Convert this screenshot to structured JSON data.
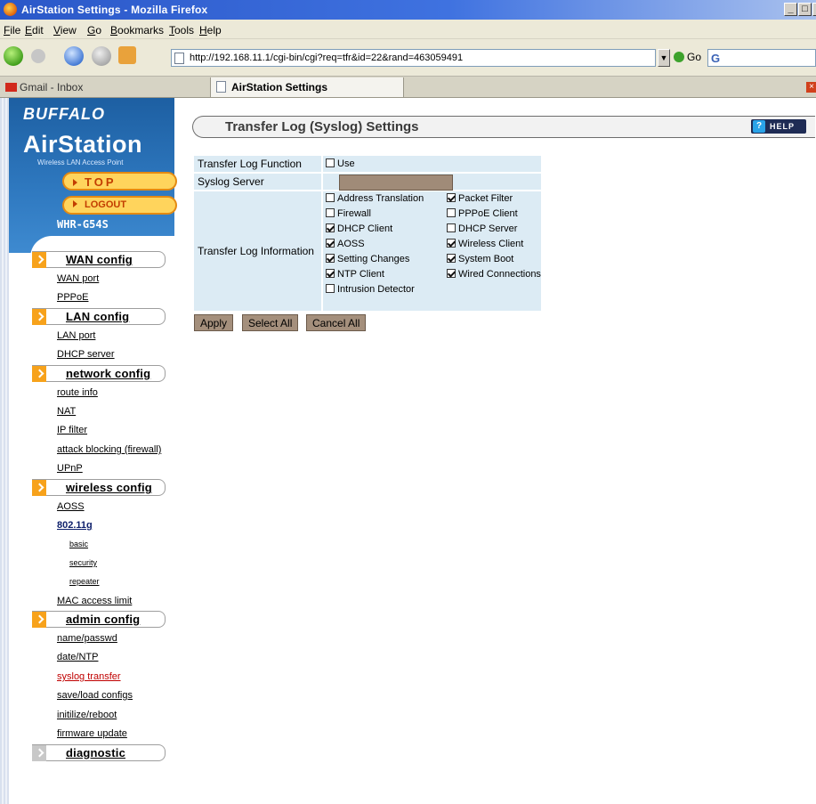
{
  "window": {
    "title": "AirStation Settings - Mozilla Firefox"
  },
  "menu": [
    "File",
    "Edit",
    "View",
    "Go",
    "Bookmarks",
    "Tools",
    "Help"
  ],
  "nav": {
    "url": "http://192.168.11.1/cgi-bin/cgi?req=tfr&id=22&rand=463059491",
    "go_label": "Go",
    "search_glyph": "G"
  },
  "tabs": [
    {
      "label": "Gmail - Inbox"
    },
    {
      "label": "AirStation Settings"
    }
  ],
  "sidebar": {
    "brand": "BUFFALO",
    "product": "AirStation",
    "product_sub": "Wireless LAN Access Point",
    "top_label": "TOP",
    "logout_label": "LOGOUT",
    "model": "WHR-G54S",
    "sections": [
      {
        "label": "WAN config",
        "items": [
          {
            "label": "WAN port"
          },
          {
            "label": "PPPoE"
          }
        ]
      },
      {
        "label": "LAN config",
        "items": [
          {
            "label": "LAN port"
          },
          {
            "label": "DHCP server"
          }
        ]
      },
      {
        "label": "network config",
        "items": [
          {
            "label": "route info"
          },
          {
            "label": "NAT"
          },
          {
            "label": "IP filter"
          },
          {
            "label": "attack blocking (firewall)"
          },
          {
            "label": "UPnP"
          }
        ]
      },
      {
        "label": "wireless config",
        "items": [
          {
            "label": "AOSS"
          },
          {
            "label": "802.11g"
          },
          {
            "label": "basic"
          },
          {
            "label": "security"
          },
          {
            "label": "repeater"
          },
          {
            "label": "MAC access limit"
          }
        ]
      },
      {
        "label": "admin config",
        "items": [
          {
            "label": "name/passwd"
          },
          {
            "label": "date/NTP"
          },
          {
            "label": "syslog transfer"
          },
          {
            "label": "save/load configs"
          },
          {
            "label": "initilize/reboot"
          },
          {
            "label": "firmware update"
          }
        ]
      },
      {
        "label": "diagnostic",
        "items": []
      }
    ]
  },
  "main": {
    "title": "Transfer Log (Syslog) Settings",
    "help_label": "HELP",
    "form": {
      "function_label": "Transfer Log Function",
      "use_label": "Use",
      "use_checked": false,
      "server_label": "Syslog Server",
      "server_value": "",
      "info_label": "Transfer Log Information",
      "options": [
        {
          "label": "Address Translation",
          "checked": false
        },
        {
          "label": "Packet Filter",
          "checked": true
        },
        {
          "label": "Firewall",
          "checked": false
        },
        {
          "label": "PPPoE Client",
          "checked": false
        },
        {
          "label": "DHCP Client",
          "checked": true
        },
        {
          "label": "DHCP Server",
          "checked": false
        },
        {
          "label": "AOSS",
          "checked": true
        },
        {
          "label": "Wireless Client",
          "checked": true
        },
        {
          "label": "Setting Changes",
          "checked": true
        },
        {
          "label": "System Boot",
          "checked": true
        },
        {
          "label": "NTP Client",
          "checked": true
        },
        {
          "label": "Wired Connections",
          "checked": true
        },
        {
          "label": "Intrusion Detector",
          "checked": false
        }
      ]
    },
    "buttons": {
      "apply": "Apply",
      "select_all": "Select All",
      "cancel_all": "Cancel All"
    }
  }
}
